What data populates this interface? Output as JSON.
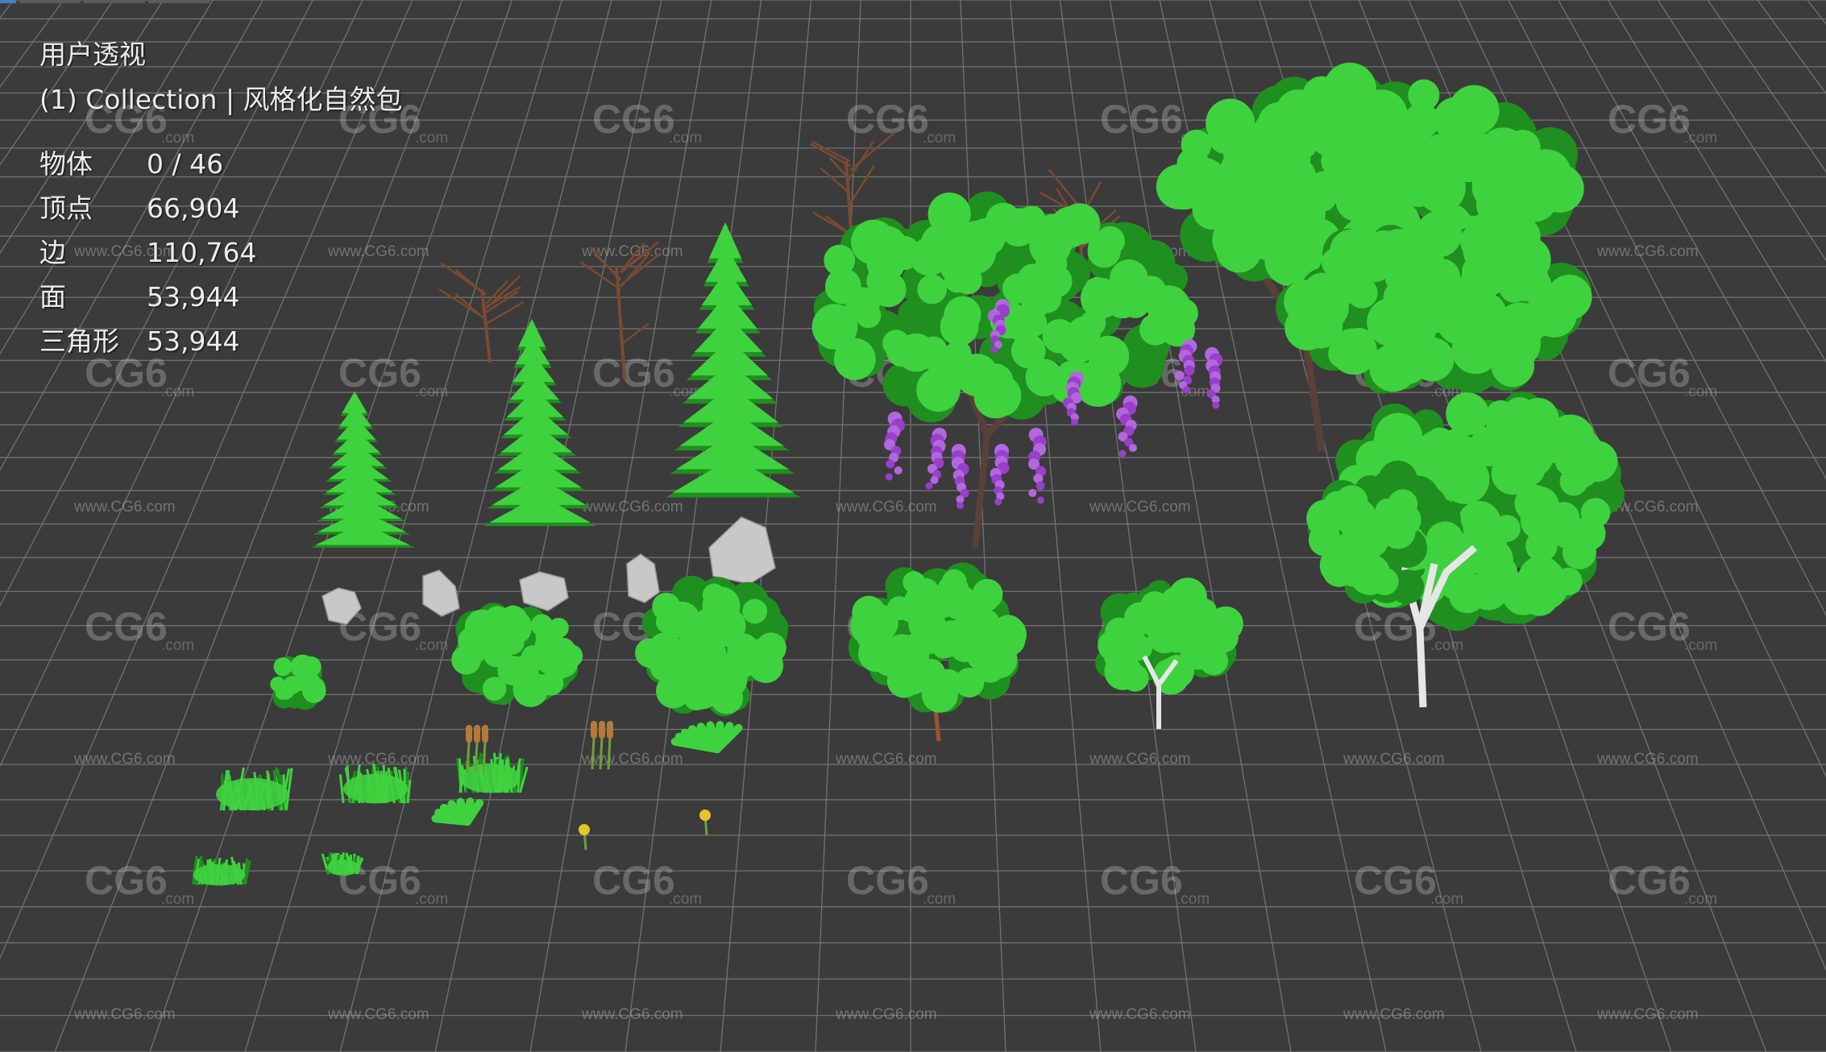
{
  "viewport": {
    "view_name": "用户透视",
    "collection_line": "(1) Collection | 风格化自然包",
    "stats": [
      {
        "label": "物体",
        "value": "0 / 46"
      },
      {
        "label": "顶点",
        "value": "66,904"
      },
      {
        "label": "边",
        "value": "110,764"
      },
      {
        "label": "面",
        "value": "53,944"
      },
      {
        "label": "三角形",
        "value": "53,944"
      }
    ]
  },
  "watermark": {
    "logo_text": "CG6",
    "logo_suffix": ".com",
    "url_text": "www.CG6.com"
  },
  "colors": {
    "background": "#3b3b3b",
    "grid_line": "#8a8a8a",
    "foliage": "#3fd23f",
    "foliage_dark": "#1f8f1f",
    "wisteria": "#9a3fc9",
    "trunk": "#6a4a3a",
    "rock": "#c8c8c8",
    "birch_bark": "#e6e6e6"
  },
  "scene_objects": [
    {
      "kind": "pine",
      "name": "pine-tree-small"
    },
    {
      "kind": "pine",
      "name": "pine-tree-medium"
    },
    {
      "kind": "pine",
      "name": "pine-tree-large"
    },
    {
      "kind": "dead-tree",
      "name": "dead-tree"
    },
    {
      "kind": "wisteria",
      "name": "wisteria-tree"
    },
    {
      "kind": "broadleaf",
      "name": "large-broadleaf-tree"
    },
    {
      "kind": "birch",
      "name": "birch-tree-large"
    },
    {
      "kind": "rock",
      "name": "rock"
    },
    {
      "kind": "bush",
      "name": "bush"
    },
    {
      "kind": "grass",
      "name": "grass-clump"
    },
    {
      "kind": "cattail",
      "name": "cattail"
    },
    {
      "kind": "fern",
      "name": "fern"
    },
    {
      "kind": "flower",
      "name": "flower"
    }
  ]
}
